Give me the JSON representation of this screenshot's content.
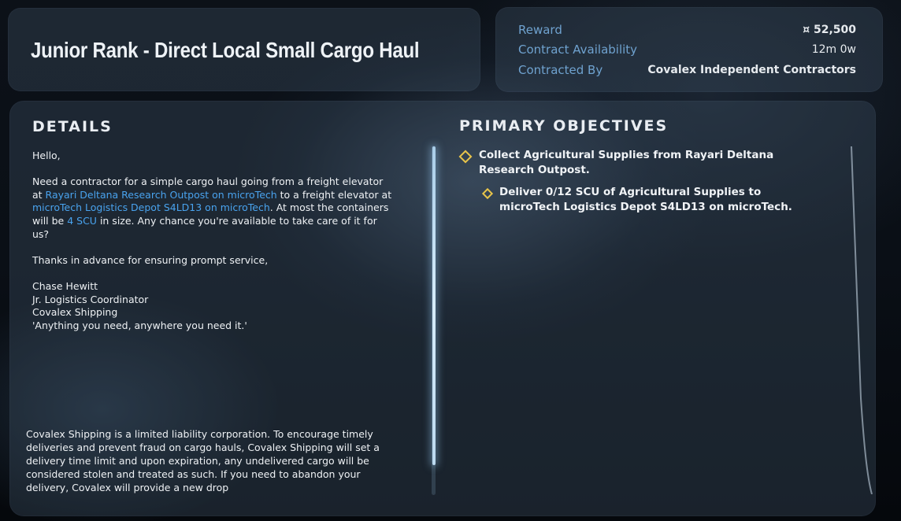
{
  "contract": {
    "title": "Junior Rank - Direct Local Small Cargo Haul"
  },
  "info": {
    "reward_label": "Reward",
    "reward_value": "¤ 52,500",
    "availability_label": "Contract Availability",
    "availability_value": "12m 0w",
    "contracted_by_label": "Contracted By",
    "contracted_by_value": "Covalex Independent Contractors"
  },
  "details": {
    "heading": "DETAILS",
    "greeting": "Hello,",
    "body_1": "Need a contractor for a simple cargo haul going from a freight elevator at ",
    "location_pickup": "Rayari Deltana Research Outpost on microTech",
    "body_2": " to a freight elevator at ",
    "location_dropoff": "microTech Logistics Depot S4LD13 on microTech",
    "body_3": ". At most the containers will be ",
    "container_size": "4 SCU",
    "body_4": " in size. Any chance you're available to take care of it for us?",
    "thanks": "Thanks in advance for ensuring prompt service,",
    "signature_name": "Chase Hewitt",
    "signature_title": "Jr. Logistics Coordinator",
    "signature_company": "Covalex Shipping",
    "signature_motto": "'Anything you need, anywhere you need it.'",
    "legal": "Covalex Shipping is a limited liability corporation. To encourage timely deliveries and prevent fraud on cargo hauls, Covalex Shipping will set a delivery time limit and upon expiration, any undelivered cargo will be considered stolen and treated as such. If you need to abandon your delivery, Covalex will provide a new drop"
  },
  "objectives": {
    "heading": "PRIMARY OBJECTIVES",
    "primary_line1": "Collect Agricultural Supplies from Rayari Deltana",
    "primary_line2": "Research Outpost.",
    "sub_line1": "Deliver 0/12 SCU of Agricultural Supplies to",
    "sub_line2": "microTech Logistics Depot S4LD13 on microTech."
  },
  "colors": {
    "link": "#49a3ee",
    "label": "#6fa2cf",
    "objective_marker": "#e8c44a"
  },
  "icons": {
    "objective_marker": "diamond-icon"
  }
}
